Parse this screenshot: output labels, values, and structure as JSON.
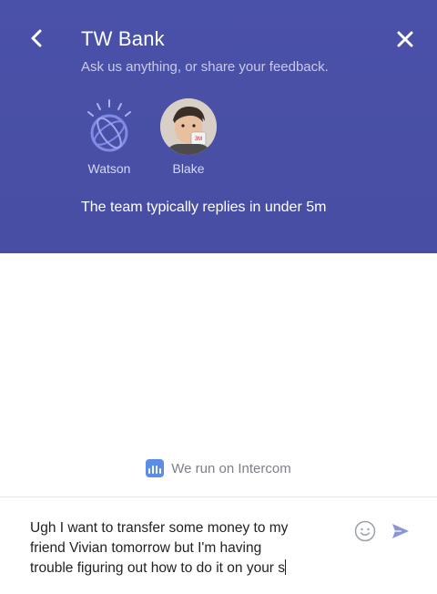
{
  "header": {
    "title": "TW Bank",
    "subtitle": "Ask us anything, or share your feedback.",
    "agents": [
      {
        "name": "Watson",
        "avatar": "watson-logo-icon"
      },
      {
        "name": "Blake",
        "avatar": "person-photo"
      }
    ],
    "reply_note": "The team typically replies in under 5m",
    "background_color": "#4a51a8",
    "back_icon": "chevron-left-icon",
    "close_icon": "close-icon"
  },
  "footer": {
    "powered_by": "We run on Intercom",
    "powered_icon": "intercom-logo-icon"
  },
  "composer": {
    "lines": [
      "Ugh I want to transfer some money to my",
      "friend Vivian tomorrow but I'm having",
      "trouble figuring out how to do it on your s"
    ],
    "emoji_icon": "smiley-icon",
    "send_icon": "send-icon",
    "accent_color": "#8a95d6"
  }
}
